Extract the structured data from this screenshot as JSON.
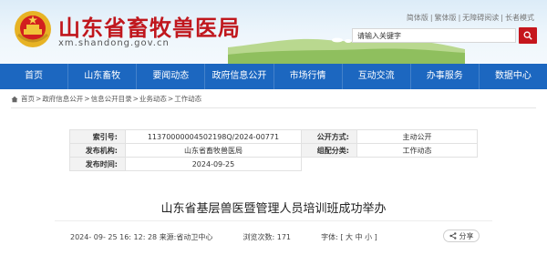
{
  "header": {
    "site_title": "山东省畜牧兽医局",
    "domain": "xm.shandong.gov.cn",
    "top_links": [
      "简体版",
      "繁体版",
      "无障碍阅读",
      "长者模式"
    ],
    "search_placeholder": "请输入关键字",
    "emblem_icon": "national-emblem-icon",
    "search_icon": "search-icon",
    "brand_color": "#c0171d"
  },
  "nav": {
    "color": "#1c67c0",
    "items": [
      "首页",
      "山东畜牧",
      "要闻动态",
      "政府信息公开",
      "市场行情",
      "互动交流",
      "办事服务",
      "数据中心"
    ]
  },
  "breadcrumb": {
    "icon": "home-icon",
    "items": [
      "首页",
      "政府信息公开",
      "信息公开目录",
      "业务动态",
      "工作动态"
    ],
    "separator": ">"
  },
  "meta": {
    "index_label": "索引号:",
    "index_value": "11370000004502198Q/2024-00771",
    "disclosure_label": "公开方式:",
    "disclosure_value": "主动公开",
    "publisher_label": "发布机构:",
    "publisher_value": "山东省畜牧兽医局",
    "category_label": "组配分类:",
    "category_value": "工作动态",
    "date_label": "发布时间:",
    "date_value": "2024-09-25"
  },
  "article": {
    "title": "山东省基层兽医暨管理人员培训班成功举办",
    "datetime": "2024- 09- 25 16: 12: 28",
    "source_label": "来源:",
    "source_value": "省动卫中心",
    "views_label": "浏览次数:",
    "views_value": "171",
    "font_label": "字体:",
    "font_options": "[ 大 中 小 ]",
    "share_label": "分享",
    "share_icon": "share-icon"
  }
}
